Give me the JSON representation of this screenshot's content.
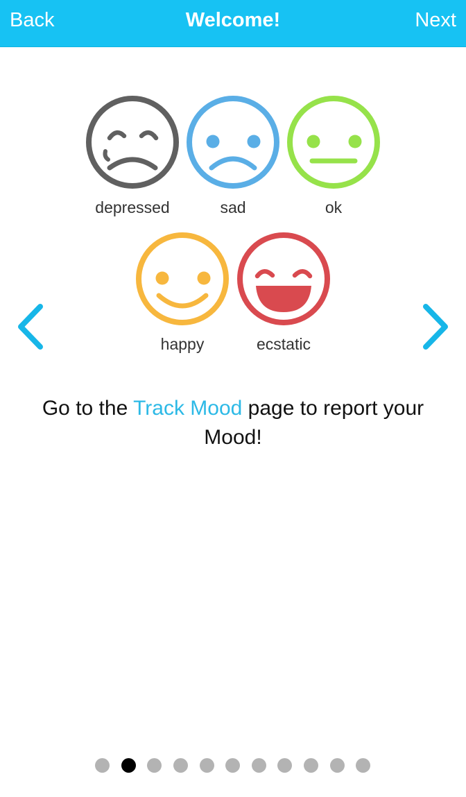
{
  "header": {
    "back_label": "Back",
    "title": "Welcome!",
    "next_label": "Next",
    "background_color": "#17c2f3"
  },
  "moods": [
    {
      "id": "depressed",
      "label": "depressed",
      "color": "#606060",
      "icon": "depressed-face-icon"
    },
    {
      "id": "sad",
      "label": "sad",
      "color": "#5aaee6",
      "icon": "sad-face-icon"
    },
    {
      "id": "ok",
      "label": "ok",
      "color": "#96e24a",
      "icon": "neutral-face-icon"
    },
    {
      "id": "happy",
      "label": "happy",
      "color": "#f7b73e",
      "icon": "happy-face-icon"
    },
    {
      "id": "ecstatic",
      "label": "ecstatic",
      "color": "#d94a4f",
      "icon": "ecstatic-face-icon"
    }
  ],
  "navigation": {
    "prev_icon": "chevron-left-icon",
    "next_icon": "chevron-right-icon",
    "arrow_color": "#17b6e8"
  },
  "message": {
    "part1": "Go to the ",
    "link": "Track Mood",
    "part2": " page to report your Mood!",
    "link_color": "#2cb9e6"
  },
  "pager": {
    "total_pages": 11,
    "current_page": 2
  }
}
